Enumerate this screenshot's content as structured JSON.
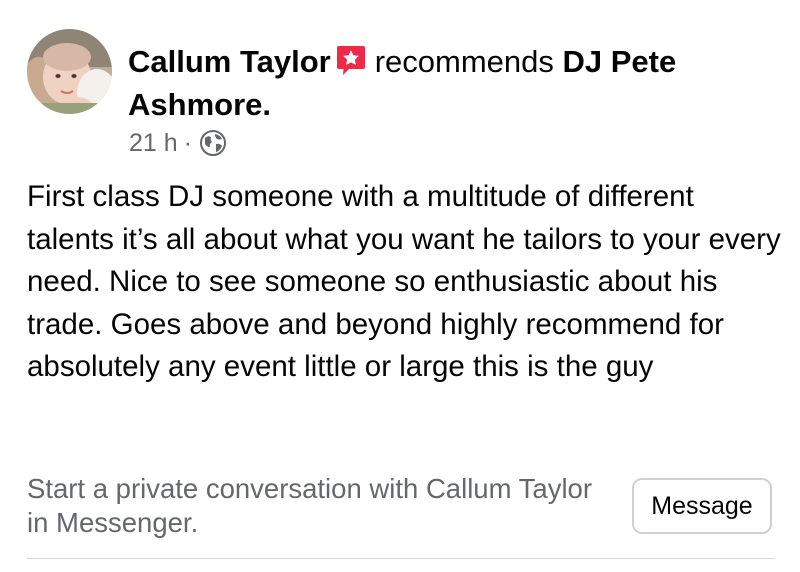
{
  "post": {
    "author": "Callum Taylor",
    "verb": "recommends",
    "page_name": "DJ Pete Ashmore",
    "page_suffix": ".",
    "timestamp": "21 h",
    "separator": "·",
    "audience_icon": "globe-icon",
    "badge_icon": "recommendation-star-badge-icon",
    "body": "First class DJ someone with a multitude of different talents it’s all about what you want he tailors to your every need. Nice to see someone so enthusiastic about his trade. Goes above and beyond highly recommend for absolutely any event little or large this is the guy"
  },
  "cta": {
    "text": "Start a private conversation with Callum Taylor in Messenger.",
    "button_label": "Message"
  },
  "colors": {
    "primary_text": "#050505",
    "secondary_text": "#65676b",
    "badge": "#f0284a",
    "button_border": "#ced0d4",
    "divider": "#d5d7db"
  }
}
